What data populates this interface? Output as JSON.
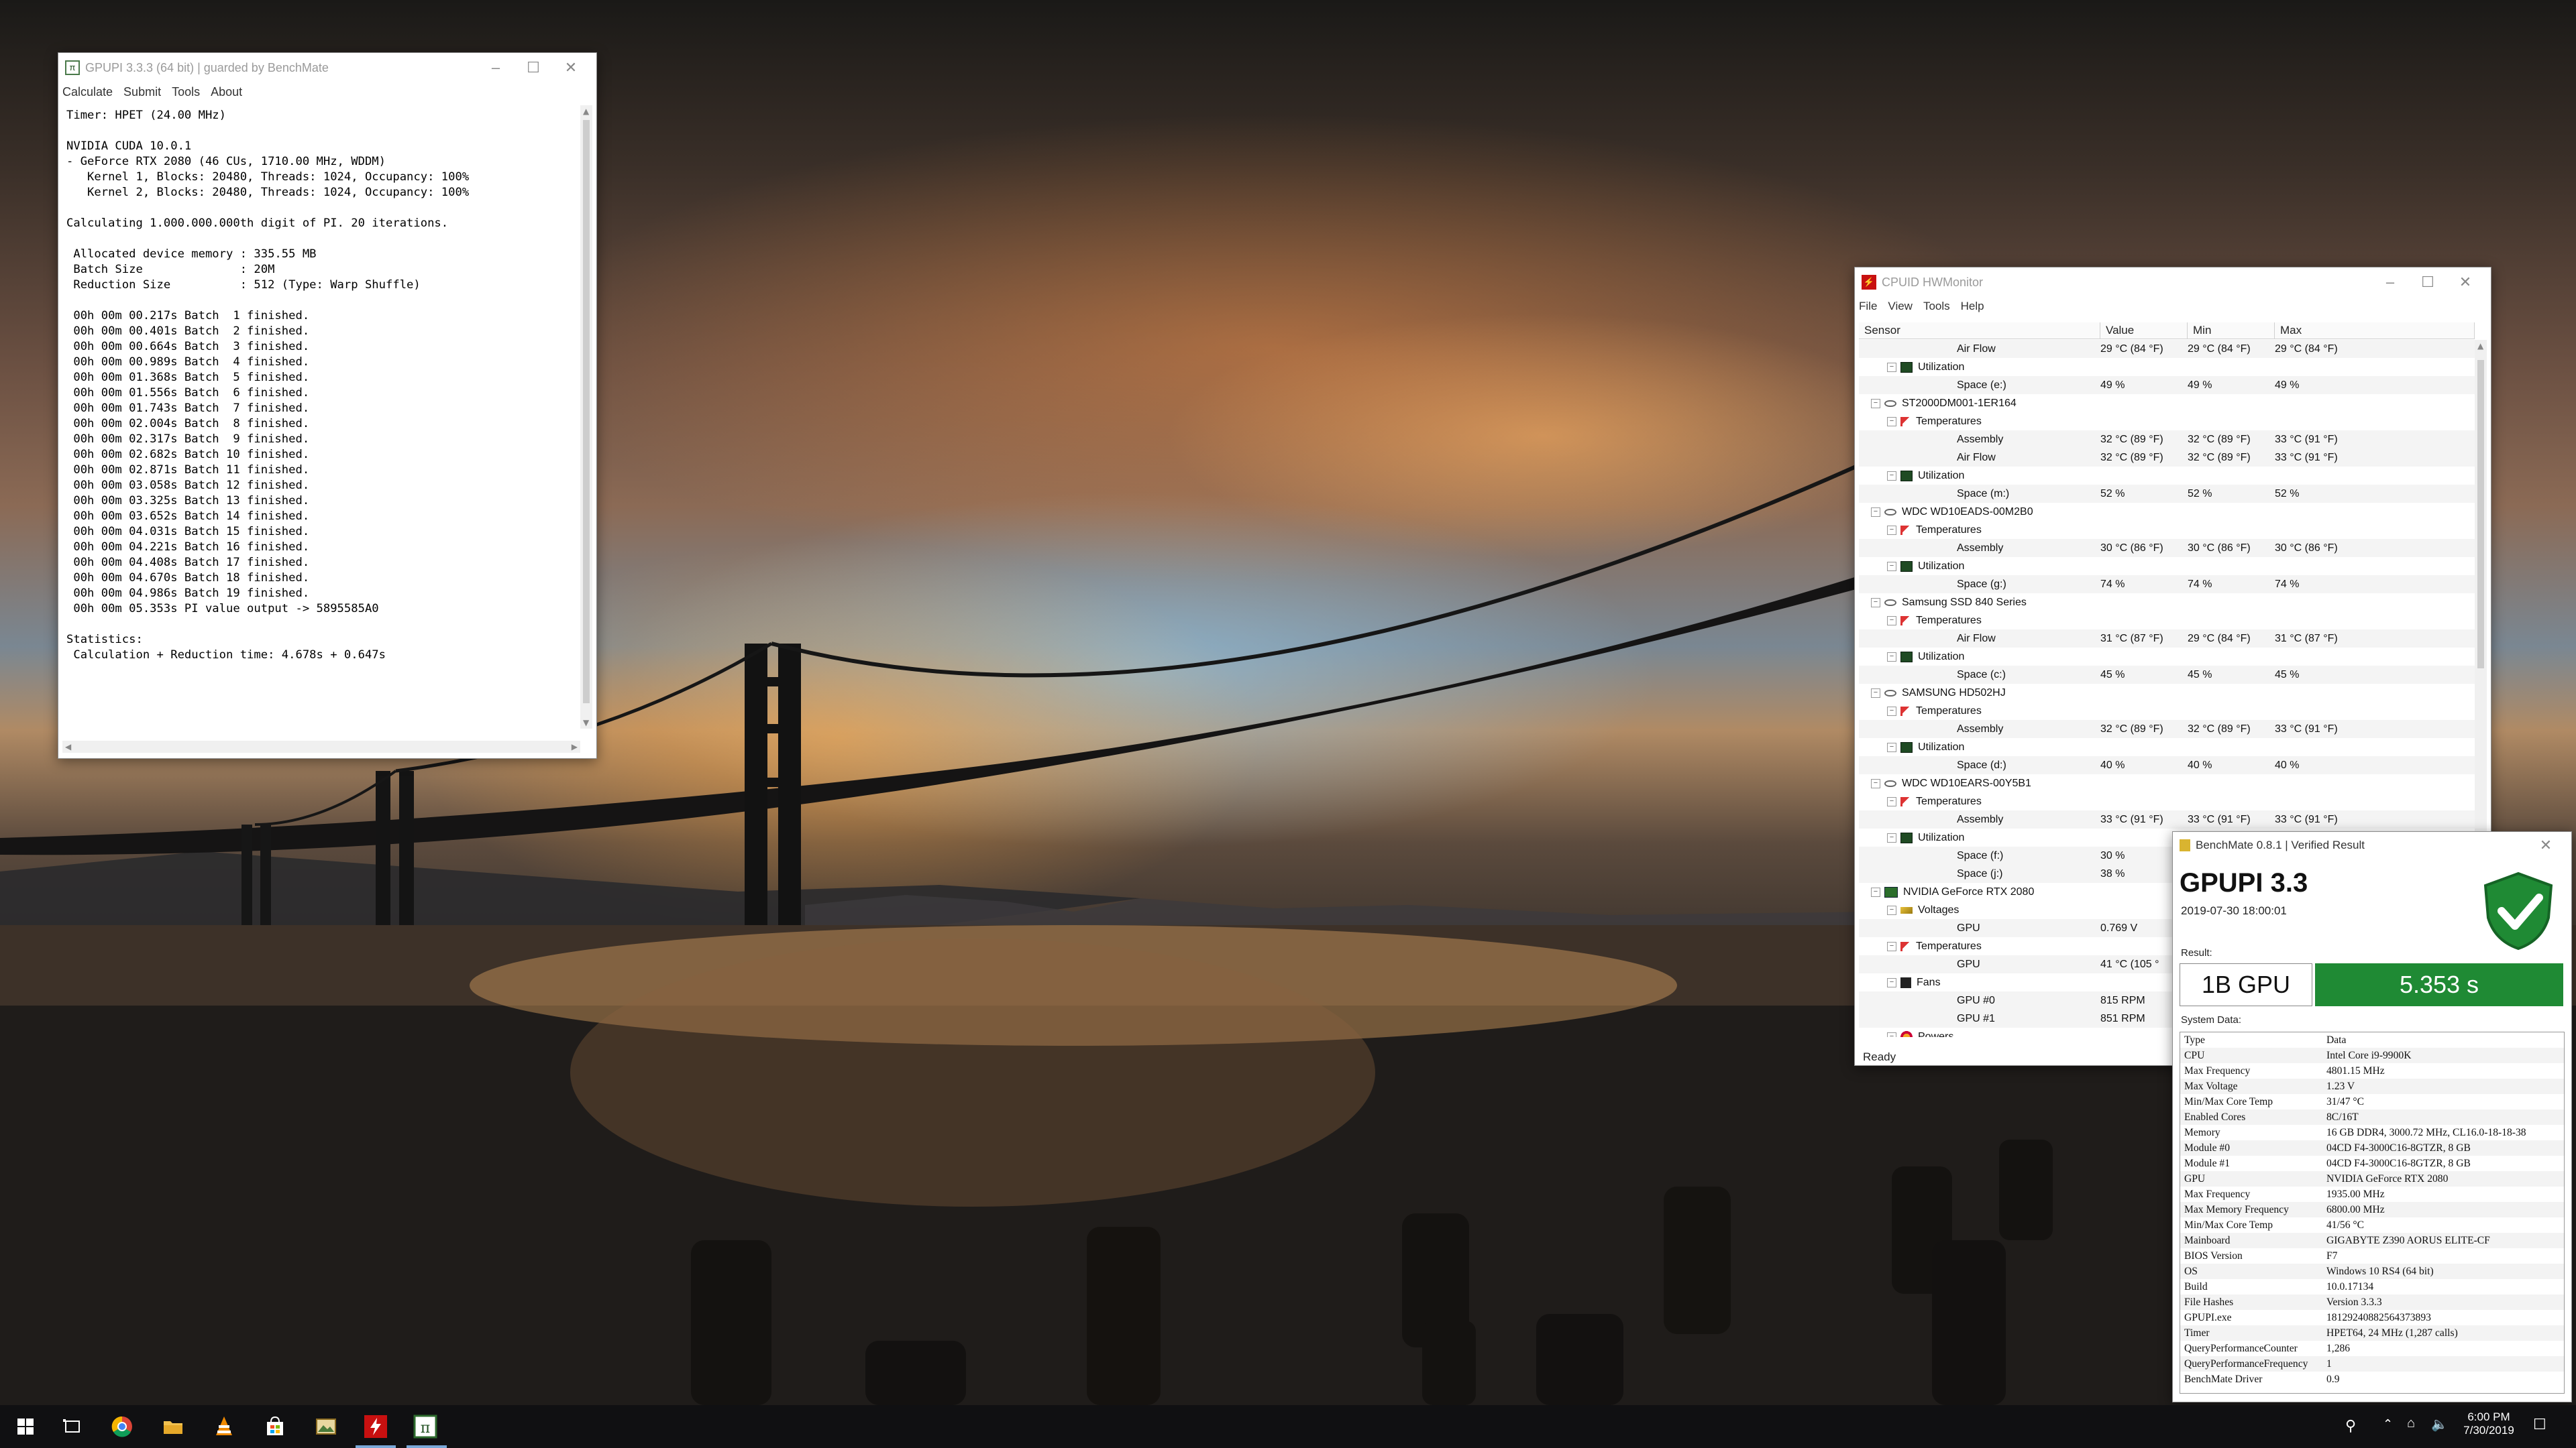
{
  "gpupi": {
    "title": "GPUPI 3.3.3 (64 bit) | guarded by BenchMate",
    "menu": [
      "Calculate",
      "Submit",
      "Tools",
      "About"
    ],
    "console_lines": [
      "Timer: HPET (24.00 MHz)",
      "",
      "NVIDIA CUDA 10.0.1",
      "- GeForce RTX 2080 (46 CUs, 1710.00 MHz, WDDM)",
      "   Kernel 1, Blocks: 20480, Threads: 1024, Occupancy: 100%",
      "   Kernel 2, Blocks: 20480, Threads: 1024, Occupancy: 100%",
      "",
      "Calculating 1.000.000.000th digit of PI. 20 iterations.",
      "",
      " Allocated device memory : 335.55 MB",
      " Batch Size              : 20M",
      " Reduction Size          : 512 (Type: Warp Shuffle)",
      "",
      " 00h 00m 00.217s Batch  1 finished.",
      " 00h 00m 00.401s Batch  2 finished.",
      " 00h 00m 00.664s Batch  3 finished.",
      " 00h 00m 00.989s Batch  4 finished.",
      " 00h 00m 01.368s Batch  5 finished.",
      " 00h 00m 01.556s Batch  6 finished.",
      " 00h 00m 01.743s Batch  7 finished.",
      " 00h 00m 02.004s Batch  8 finished.",
      " 00h 00m 02.317s Batch  9 finished.",
      " 00h 00m 02.682s Batch 10 finished.",
      " 00h 00m 02.871s Batch 11 finished.",
      " 00h 00m 03.058s Batch 12 finished.",
      " 00h 00m 03.325s Batch 13 finished.",
      " 00h 00m 03.652s Batch 14 finished.",
      " 00h 00m 04.031s Batch 15 finished.",
      " 00h 00m 04.221s Batch 16 finished.",
      " 00h 00m 04.408s Batch 17 finished.",
      " 00h 00m 04.670s Batch 18 finished.",
      " 00h 00m 04.986s Batch 19 finished.",
      " 00h 00m 05.353s PI value output -> 5895585A0",
      "",
      "Statistics:",
      " Calculation + Reduction time: 4.678s + 0.647s"
    ]
  },
  "hwmonitor": {
    "title": "CPUID HWMonitor",
    "menu": [
      "File",
      "View",
      "Tools",
      "Help"
    ],
    "columns": [
      "Sensor",
      "Value",
      "Min",
      "Max"
    ],
    "status": "Ready",
    "rows": [
      {
        "level": 3,
        "icon": "none",
        "label": "Air Flow",
        "value": "29 °C  (84 °F)",
        "min": "29 °C  (84 °F)",
        "max": "29 °C  (84 °F)"
      },
      {
        "level": 2,
        "icon": "util",
        "label": "Utilization",
        "value": "",
        "min": "",
        "max": ""
      },
      {
        "level": 3,
        "icon": "none",
        "label": "Space (e:)",
        "value": "49 %",
        "min": "49 %",
        "max": "49 %"
      },
      {
        "level": 1,
        "icon": "hdd",
        "label": "ST2000DM001-1ER164",
        "value": "",
        "min": "",
        "max": ""
      },
      {
        "level": 2,
        "icon": "temp",
        "label": "Temperatures",
        "value": "",
        "min": "",
        "max": ""
      },
      {
        "level": 3,
        "icon": "none",
        "label": "Assembly",
        "value": "32 °C  (89 °F)",
        "min": "32 °C  (89 °F)",
        "max": "33 °C  (91 °F)"
      },
      {
        "level": 3,
        "icon": "none",
        "label": "Air Flow",
        "value": "32 °C  (89 °F)",
        "min": "32 °C  (89 °F)",
        "max": "33 °C  (91 °F)"
      },
      {
        "level": 2,
        "icon": "util",
        "label": "Utilization",
        "value": "",
        "min": "",
        "max": ""
      },
      {
        "level": 3,
        "icon": "none",
        "label": "Space (m:)",
        "value": "52 %",
        "min": "52 %",
        "max": "52 %"
      },
      {
        "level": 1,
        "icon": "hdd",
        "label": "WDC WD10EADS-00M2B0",
        "value": "",
        "min": "",
        "max": ""
      },
      {
        "level": 2,
        "icon": "temp",
        "label": "Temperatures",
        "value": "",
        "min": "",
        "max": ""
      },
      {
        "level": 3,
        "icon": "none",
        "label": "Assembly",
        "value": "30 °C  (86 °F)",
        "min": "30 °C  (86 °F)",
        "max": "30 °C  (86 °F)"
      },
      {
        "level": 2,
        "icon": "util",
        "label": "Utilization",
        "value": "",
        "min": "",
        "max": ""
      },
      {
        "level": 3,
        "icon": "none",
        "label": "Space (g:)",
        "value": "74 %",
        "min": "74 %",
        "max": "74 %"
      },
      {
        "level": 1,
        "icon": "hdd",
        "label": "Samsung SSD 840 Series",
        "value": "",
        "min": "",
        "max": ""
      },
      {
        "level": 2,
        "icon": "temp",
        "label": "Temperatures",
        "value": "",
        "min": "",
        "max": ""
      },
      {
        "level": 3,
        "icon": "none",
        "label": "Air Flow",
        "value": "31 °C  (87 °F)",
        "min": "29 °C  (84 °F)",
        "max": "31 °C  (87 °F)"
      },
      {
        "level": 2,
        "icon": "util",
        "label": "Utilization",
        "value": "",
        "min": "",
        "max": ""
      },
      {
        "level": 3,
        "icon": "none",
        "label": "Space (c:)",
        "value": "45 %",
        "min": "45 %",
        "max": "45 %"
      },
      {
        "level": 1,
        "icon": "hdd",
        "label": "SAMSUNG HD502HJ",
        "value": "",
        "min": "",
        "max": ""
      },
      {
        "level": 2,
        "icon": "temp",
        "label": "Temperatures",
        "value": "",
        "min": "",
        "max": ""
      },
      {
        "level": 3,
        "icon": "none",
        "label": "Assembly",
        "value": "32 °C  (89 °F)",
        "min": "32 °C  (89 °F)",
        "max": "33 °C  (91 °F)"
      },
      {
        "level": 2,
        "icon": "util",
        "label": "Utilization",
        "value": "",
        "min": "",
        "max": ""
      },
      {
        "level": 3,
        "icon": "none",
        "label": "Space (d:)",
        "value": "40 %",
        "min": "40 %",
        "max": "40 %"
      },
      {
        "level": 1,
        "icon": "hdd",
        "label": "WDC WD10EARS-00Y5B1",
        "value": "",
        "min": "",
        "max": ""
      },
      {
        "level": 2,
        "icon": "temp",
        "label": "Temperatures",
        "value": "",
        "min": "",
        "max": ""
      },
      {
        "level": 3,
        "icon": "none",
        "label": "Assembly",
        "value": "33 °C  (91 °F)",
        "min": "33 °C  (91 °F)",
        "max": "33 °C  (91 °F)"
      },
      {
        "level": 2,
        "icon": "util",
        "label": "Utilization",
        "value": "",
        "min": "",
        "max": ""
      },
      {
        "level": 3,
        "icon": "none",
        "label": "Space (f:)",
        "value": "30 %",
        "min": "",
        "max": ""
      },
      {
        "level": 3,
        "icon": "none",
        "label": "Space (j:)",
        "value": "38 %",
        "min": "",
        "max": ""
      },
      {
        "level": 1,
        "icon": "gpu",
        "label": "NVIDIA GeForce RTX 2080",
        "value": "",
        "min": "",
        "max": ""
      },
      {
        "level": 2,
        "icon": "volt",
        "label": "Voltages",
        "value": "",
        "min": "",
        "max": ""
      },
      {
        "level": 3,
        "icon": "none",
        "label": "GPU",
        "value": "0.769 V",
        "min": "",
        "max": ""
      },
      {
        "level": 2,
        "icon": "temp",
        "label": "Temperatures",
        "value": "",
        "min": "",
        "max": ""
      },
      {
        "level": 3,
        "icon": "none",
        "label": "GPU",
        "value": "41 °C  (105 °",
        "min": "",
        "max": ""
      },
      {
        "level": 2,
        "icon": "fan",
        "label": "Fans",
        "value": "",
        "min": "",
        "max": ""
      },
      {
        "level": 3,
        "icon": "none",
        "label": "GPU #0",
        "value": "815 RPM",
        "min": "",
        "max": ""
      },
      {
        "level": 3,
        "icon": "none",
        "label": "GPU #1",
        "value": "851 RPM",
        "min": "",
        "max": ""
      },
      {
        "level": 2,
        "icon": "pow",
        "label": "Powers",
        "value": "",
        "min": "",
        "max": ""
      }
    ]
  },
  "benchmate": {
    "title": "BenchMate 0.8.1 | Verified Result",
    "bench_name": "GPUPI 3.3",
    "datetime": "2019-07-30 18:00:01",
    "result_label": "Result:",
    "benchmark": "1B GPU",
    "score": "5.353 s",
    "system_data_label": "System Data:",
    "accent_color": "#1f8a34",
    "rows": [
      [
        "Type",
        "Data"
      ],
      [
        "CPU",
        "Intel Core i9-9900K"
      ],
      [
        "Max Frequency",
        "4801.15 MHz"
      ],
      [
        "Max Voltage",
        "1.23 V"
      ],
      [
        "Min/Max Core Temp",
        "31/47 °C"
      ],
      [
        "Enabled Cores",
        "8C/16T"
      ],
      [
        "Memory",
        "16 GB DDR4, 3000.72 MHz, CL16.0-18-18-38"
      ],
      [
        "Module #0",
        "04CD F4-3000C16-8GTZR, 8 GB"
      ],
      [
        "Module #1",
        "04CD F4-3000C16-8GTZR, 8 GB"
      ],
      [
        "GPU",
        "NVIDIA GeForce RTX 2080"
      ],
      [
        "Max Frequency",
        "1935.00 MHz"
      ],
      [
        "Max Memory Frequency",
        "6800.00 MHz"
      ],
      [
        "Min/Max Core Temp",
        "41/56 °C"
      ],
      [
        "Mainboard",
        "GIGABYTE Z390 AORUS ELITE-CF"
      ],
      [
        "BIOS Version",
        "F7"
      ],
      [
        "OS",
        "Windows 10 RS4 (64 bit)"
      ],
      [
        "Build",
        "10.0.17134"
      ],
      [
        "File Hashes",
        "Version 3.3.3"
      ],
      [
        "GPUPI.exe",
        "18129240882564373893"
      ],
      [
        "Timer",
        "HPET64, 24 MHz (1,287 calls)"
      ],
      [
        "QueryPerformanceCounter",
        "1,286"
      ],
      [
        "QueryPerformanceFrequency",
        "1"
      ],
      [
        "BenchMate Driver",
        "0.9"
      ]
    ]
  },
  "taskbar": {
    "time": "6:00 PM",
    "date": "7/30/2019",
    "pinned": [
      "start-icon",
      "task-view-icon",
      "chrome-icon",
      "file-explorer-icon",
      "vlc-icon",
      "store-icon",
      "gallery-icon",
      "hwmonitor-icon",
      "gpupi-icon"
    ]
  }
}
